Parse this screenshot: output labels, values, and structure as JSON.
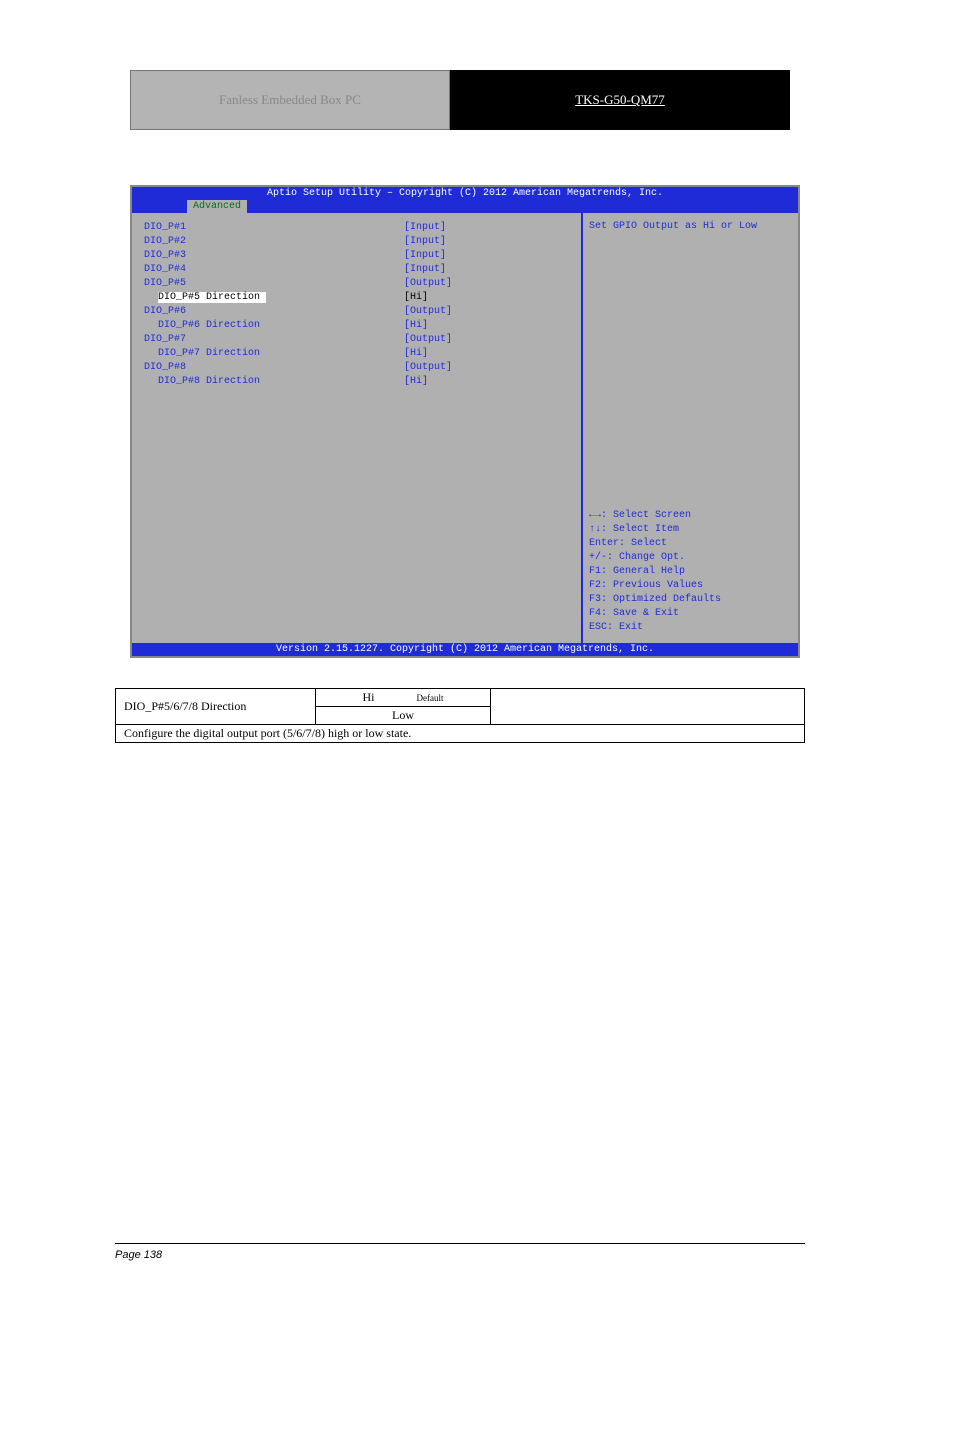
{
  "header": {
    "left": "Fanless Embedded Box PC",
    "right": "TKS-G50-QM77"
  },
  "bios": {
    "title": "Aptio Setup Utility – Copyright (C) 2012 American Megatrends, Inc.",
    "tab": "Advanced",
    "help": "Set GPIO Output as Hi or Low",
    "rows": [
      {
        "label": "DIO_P#1",
        "value": "[Input]",
        "indented": false,
        "selected": false
      },
      {
        "label": "DIO_P#2",
        "value": "[Input]",
        "indented": false,
        "selected": false
      },
      {
        "label": "DIO_P#3",
        "value": "[Input]",
        "indented": false,
        "selected": false
      },
      {
        "label": "DIO_P#4",
        "value": "[Input]",
        "indented": false,
        "selected": false
      },
      {
        "label": "DIO_P#5",
        "value": "[Output]",
        "indented": false,
        "selected": false
      },
      {
        "label": "DIO_P#5 Direction",
        "value": "[Hi]",
        "indented": true,
        "selected": true
      },
      {
        "label": "DIO_P#6",
        "value": "[Output]",
        "indented": false,
        "selected": false
      },
      {
        "label": "DIO_P#6 Direction",
        "value": "[Hi]",
        "indented": true,
        "selected": false
      },
      {
        "label": "DIO_P#7",
        "value": "[Output]",
        "indented": false,
        "selected": false
      },
      {
        "label": "DIO_P#7 Direction",
        "value": "[Hi]",
        "indented": true,
        "selected": false
      },
      {
        "label": "DIO_P#8",
        "value": "[Output]",
        "indented": false,
        "selected": false
      },
      {
        "label": "DIO_P#8 Direction",
        "value": "[Hi]",
        "indented": true,
        "selected": false
      }
    ],
    "hints": [
      "←→: Select Screen",
      "↑↓: Select Item",
      "Enter: Select",
      "+/-: Change Opt.",
      "F1: General Help",
      "F2: Previous Values",
      "F3: Optimized Defaults",
      "F4: Save & Exit",
      "ESC: Exit"
    ],
    "footer": "Version 2.15.1227. Copyright (C) 2012 American Megatrends, Inc."
  },
  "table": {
    "label": "DIO_P#5/6/7/8 Direction",
    "opts": [
      "Hi",
      "Low"
    ],
    "default_note": "Default",
    "desc": "Configure the digital output port (5/6/7/8) high or low state."
  },
  "footer": {
    "left": "Page 138",
    "right": ""
  }
}
